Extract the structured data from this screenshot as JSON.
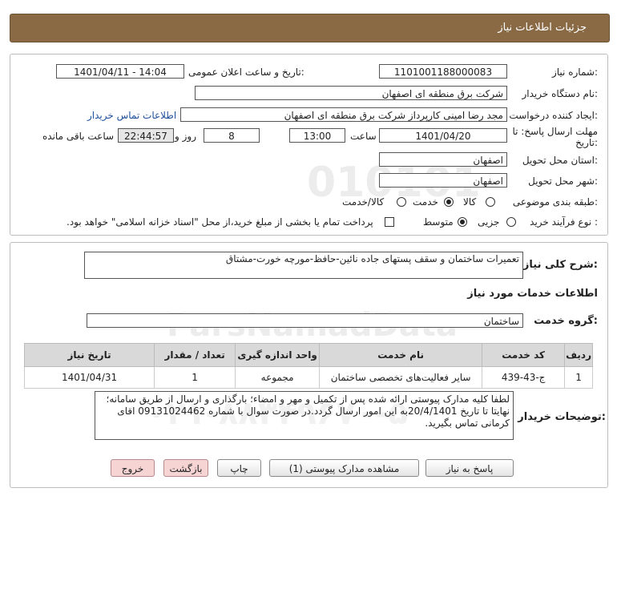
{
  "header": {
    "title": "جزئیات اطلاعات نیاز"
  },
  "watermark": {
    "digits": "010101",
    "brand": "ParsNamadData",
    "phone": "۰۲۱-۸۸۳۴۹۶۷۰-۵"
  },
  "form": {
    "need_number_label": "شماره نیاز:",
    "need_number": "1101001188000083",
    "announce_label": "تاریخ و ساعت اعلان عمومی:",
    "announce_value": "1401/04/11 - 14:04",
    "buyer_label": "نام دستگاه خریدار:",
    "buyer_value": "شرکت برق منطقه ای اصفهان",
    "creator_label": "ایجاد کننده درخواست:",
    "creator_value": "مجد رضا امینی کارپرداز شرکت برق منطقه ای اصفهان",
    "contact_link": "اطلاعات تماس خریدار",
    "deadline_label": "مهلت ارسال پاسخ: تا تاریخ:",
    "deadline_date": "1401/04/20",
    "time_label": "ساعت",
    "deadline_time": "13:00",
    "days_value": "8",
    "days_label": "روز و",
    "remaining_value": "22:44:57",
    "remaining_label": "ساعت باقی مانده",
    "province_label": "استان محل تحویل:",
    "province_value": "اصفهان",
    "city_label": "شهر محل تحویل:",
    "city_value": "اصفهان",
    "category_label": "طبقه بندی موضوعی:",
    "category_options": [
      "کالا",
      "خدمت",
      "کالا/خدمت"
    ],
    "category_selected": "خدمت",
    "purchase_label": "نوع فرآیند خرید :",
    "purchase_options": [
      "جزیی",
      "متوسط"
    ],
    "purchase_selected": "متوسط",
    "payment_note": "پرداخت تمام یا بخشی از مبلغ خرید،از محل \"اسناد خزانه اسلامی\" خواهد بود."
  },
  "details": {
    "summary_label": "شرح کلی نیاز:",
    "summary_value": "تعمیرات ساختمان و سقف پستهای جاده نائین-حافظ-مورچه خورت-مشتاق",
    "services_title": "اطلاعات خدمات مورد نیاز",
    "group_label": "گروه خدمت:",
    "group_value": "ساختمان",
    "table": {
      "headers": [
        "ردیف",
        "کد خدمت",
        "نام خدمت",
        "واحد اندازه گیری",
        "تعداد / مقدار",
        "تاریخ نیاز"
      ],
      "rows": [
        [
          "1",
          "ج-43-439",
          "سایر فعالیت‌های تخصصی ساختمان",
          "مجموعه",
          "1",
          "1401/04/31"
        ]
      ]
    },
    "buyer_notes_label": "توضیحات خریدار:",
    "buyer_notes": "لطفا کلیه مدارک پیوستی ارائه شده  پس از تکمیل و مهر و امضاء؛ بارگذاری و ارسال از طریق سامانه؛ نهایتا تا تاریخ 20/4/1401به این امور ارسال گردد.در صورت سوال با شماره 09131024462 اقای کرمانی تماس بگیرید."
  },
  "buttons": {
    "reply": "پاسخ به نیاز",
    "attachments": "مشاهده مدارک پیوستی (1)",
    "print": "چاپ",
    "back": "بازگشت",
    "exit": "خروج"
  }
}
